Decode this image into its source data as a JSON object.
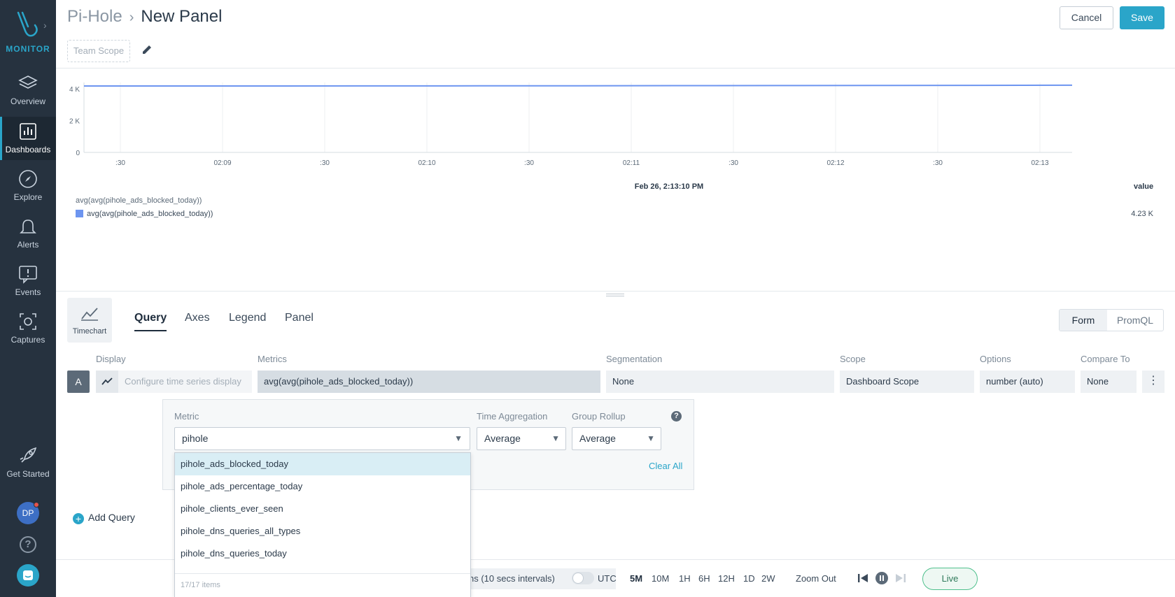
{
  "sidebar": {
    "logo_text": "MONITOR",
    "items": [
      {
        "label": "Overview",
        "icon": "layers-icon"
      },
      {
        "label": "Dashboards",
        "icon": "bar-chart-icon"
      },
      {
        "label": "Explore",
        "icon": "compass-icon"
      },
      {
        "label": "Alerts",
        "icon": "bell-icon"
      },
      {
        "label": "Events",
        "icon": "event-message-icon"
      },
      {
        "label": "Captures",
        "icon": "capture-icon"
      }
    ],
    "get_started": "Get Started",
    "avatar_initials": "DP",
    "help_glyph": "?"
  },
  "header": {
    "breadcrumb_parent": "Pi-Hole",
    "breadcrumb_current": "New Panel",
    "scope_placeholder": "Team Scope",
    "cancel_label": "Cancel",
    "save_label": "Save"
  },
  "chart_data": {
    "type": "line",
    "y_ticks": [
      "4 K",
      "2 K",
      "0"
    ],
    "ylim": [
      0,
      4400
    ],
    "x_tick_labels": [
      ":30",
      "02:09",
      ":30",
      "02:10",
      ":30",
      "02:11",
      ":30",
      "02:12",
      ":30",
      "02:13"
    ],
    "hover_time": "Feb 26, 2:13:10 PM",
    "value_header": "value",
    "series": [
      {
        "name": "avg(avg(pihole_ads_blocked_today))",
        "color": "#6d95f0",
        "values": [
          4180,
          4180,
          4180,
          4185,
          4190,
          4195,
          4200,
          4205,
          4210,
          4220,
          4230
        ]
      }
    ],
    "legend_title": "avg(avg(pihole_ads_blocked_today))",
    "legend_value": "4.23 K"
  },
  "editor": {
    "vis_label": "Timechart",
    "tabs": [
      "Query",
      "Axes",
      "Legend",
      "Panel"
    ],
    "active_tab": "Query",
    "mode_form": "Form",
    "mode_promql": "PromQL",
    "columns": {
      "display": "Display",
      "metrics": "Metrics",
      "segmentation": "Segmentation",
      "scope": "Scope",
      "options": "Options",
      "compare_to": "Compare To"
    },
    "query": {
      "letter": "A",
      "display_placeholder": "Configure time series display",
      "metrics": "avg(avg(pihole_ads_blocked_today))",
      "segmentation": "None",
      "scope": "Dashboard Scope",
      "options": "number (auto)",
      "compare_to": "None",
      "kebab": "⋮"
    },
    "metric_popover": {
      "metric_label": "Metric",
      "time_agg_label": "Time Aggregation",
      "group_rollup_label": "Group Rollup",
      "metric_value": "pihole",
      "time_agg_value": "Average",
      "group_rollup_value": "Average",
      "clear_all": "Clear All",
      "help_glyph": "?"
    },
    "dropdown": {
      "items": [
        "pihole_ads_blocked_today",
        "pihole_ads_percentage_today",
        "pihole_clients_ever_seen",
        "pihole_dns_queries_all_types",
        "pihole_dns_queries_today"
      ],
      "footer": "17/17 items"
    },
    "add_query": "Add Query"
  },
  "footer": {
    "interval_text": "ns (10 secs intervals)",
    "utc_label": "UTC",
    "ranges": [
      "5M",
      "10M",
      "1H",
      "6H",
      "12H",
      "1D",
      "2W"
    ],
    "active_range": "5M",
    "zoom_out": "Zoom Out",
    "live": "Live"
  },
  "colors": {
    "sidebar_bg": "#26323f",
    "accent": "#2aa5c9",
    "series": "#6d95f0"
  }
}
